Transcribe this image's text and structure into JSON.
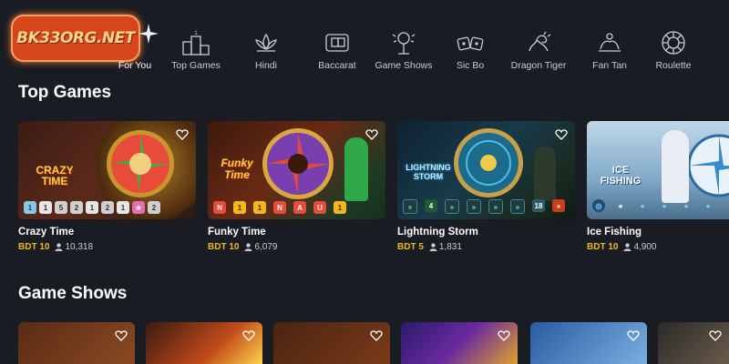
{
  "logo": {
    "text": "BK33ORG.NET"
  },
  "nav": [
    {
      "label": "For You",
      "icon": "sparkle-icon",
      "active": true
    },
    {
      "label": "Top Games",
      "icon": "podium-icon"
    },
    {
      "label": "Hindi",
      "icon": "lotus-icon"
    },
    {
      "label": "Baccarat",
      "icon": "cards-icon"
    },
    {
      "label": "Game Shows",
      "icon": "microphone-icon"
    },
    {
      "label": "Sic Bo",
      "icon": "dice-icon"
    },
    {
      "label": "Dragon Tiger",
      "icon": "dragon-icon"
    },
    {
      "label": "Fan Tan",
      "icon": "hands-icon"
    },
    {
      "label": "Roulette",
      "icon": "roulette-icon"
    }
  ],
  "top_games": {
    "title": "Top Games",
    "cards": [
      {
        "name": "Crazy Time",
        "bet": "BDT 10",
        "players": "10,318",
        "art": "CRAZY TIME",
        "pills": [
          "1",
          "1",
          "5",
          "2",
          "1",
          "2",
          "1",
          "★",
          "2"
        ]
      },
      {
        "name": "Funky Time",
        "bet": "BDT 10",
        "players": "6,079",
        "art": "Funky Time",
        "pills": [
          "N",
          "1",
          "1",
          "N",
          "A",
          "U",
          "1"
        ]
      },
      {
        "name": "Lightning Storm",
        "bet": "BDT 5",
        "players": "1,831",
        "art": "LIGHTNING STORM",
        "pills": [
          "»",
          "4",
          "»",
          "»",
          "»",
          "»",
          "18",
          "»"
        ]
      },
      {
        "name": "Ice Fishing",
        "bet": "BDT 10",
        "players": "4,900",
        "art": "ICE FISHING",
        "pills": [
          "◎",
          "●",
          "●",
          "●",
          "●",
          "●"
        ]
      }
    ]
  },
  "game_shows": {
    "title": "Game Shows"
  },
  "colors": {
    "background": "#1a1c24",
    "accent": "#f3b71b"
  }
}
